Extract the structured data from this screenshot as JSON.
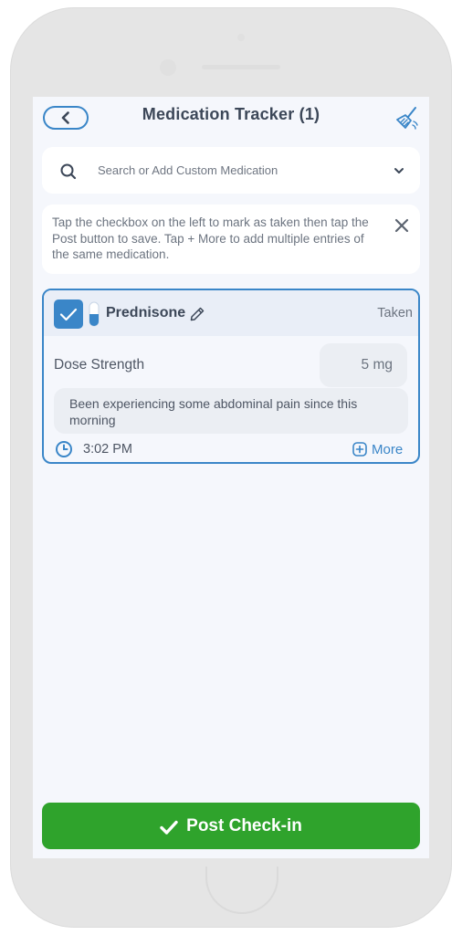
{
  "header": {
    "title": "Medication Tracker (1)",
    "back_icon": "chevron-left-icon",
    "clear_icon": "broom-icon"
  },
  "search": {
    "placeholder": "Search or Add Custom Medication",
    "icon": "search-icon",
    "dropdown_icon": "chevron-down-icon"
  },
  "info": {
    "text": "Tap the checkbox on the left to mark as taken then tap the Post button to save. Tap + More to add multiple entries of the same medication.",
    "close_icon": "close-icon"
  },
  "medication": {
    "checked": true,
    "name": "Prednisone",
    "status": "Taken",
    "dose_label": "Dose Strength",
    "dose_value": "5 mg",
    "note": "Been experiencing some abdominal pain since this morning",
    "time": "3:02 PM",
    "more_label": "More"
  },
  "footer": {
    "post_label": "Post Check-in"
  },
  "colors": {
    "accent": "#3a86c8",
    "post_button": "#2fa32c",
    "title_text": "#3c4758",
    "screen_bg": "#f5f7fc"
  }
}
